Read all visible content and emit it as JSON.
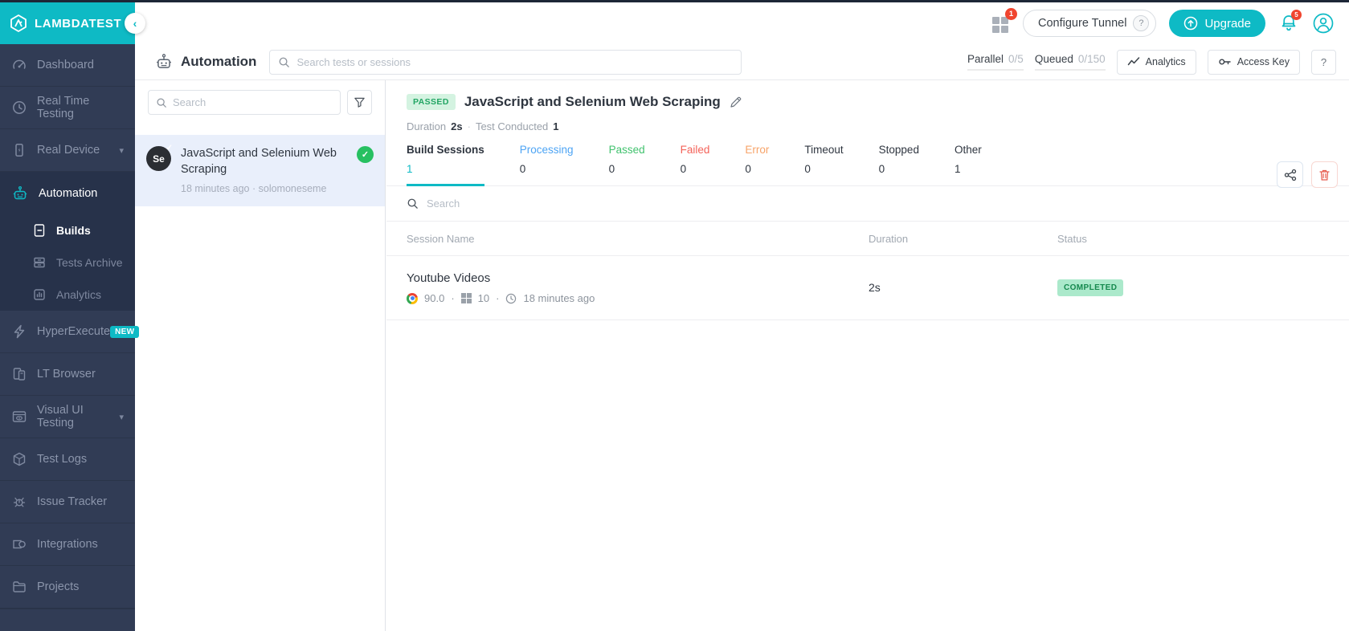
{
  "brand": {
    "name": "LAMBDATEST",
    "teal": "#0ebac5"
  },
  "sidebar": {
    "items": [
      {
        "label": "Dashboard"
      },
      {
        "label": "Real Time Testing"
      },
      {
        "label": "Real Device"
      },
      {
        "label": "Automation"
      },
      {
        "label": "Builds"
      },
      {
        "label": "Tests Archive"
      },
      {
        "label": "Analytics"
      },
      {
        "label": "HyperExecute",
        "badge": "NEW"
      },
      {
        "label": "LT Browser"
      },
      {
        "label": "Visual UI Testing"
      },
      {
        "label": "Test Logs"
      },
      {
        "label": "Issue Tracker"
      },
      {
        "label": "Integrations"
      },
      {
        "label": "Projects"
      }
    ]
  },
  "topbar": {
    "apps_badge": "1",
    "configure_tunnel_label": "Configure Tunnel",
    "tunnel_help": "?",
    "upgrade_label": "Upgrade",
    "bell_badge": "5"
  },
  "header": {
    "title": "Automation",
    "search_placeholder": "Search tests or sessions",
    "parallel_label": "Parallel",
    "parallel_value": "0/5",
    "queued_label": "Queued",
    "queued_value": "0/150",
    "analytics_button": "Analytics",
    "access_key_button": "Access Key",
    "help_button": "?"
  },
  "build_list": {
    "search_placeholder": "Search",
    "items": [
      {
        "title": "JavaScript and Selenium Web Scraping",
        "time": "18 minutes ago",
        "separator": "·",
        "user": "solomoneseme",
        "status": "passed"
      }
    ]
  },
  "detail": {
    "status_badge": "PASSED",
    "title": "JavaScript and Selenium Web Scraping",
    "duration_label": "Duration",
    "duration_value": "2s",
    "meta_separator": "·",
    "tests_label": "Test Conducted",
    "tests_value": "1",
    "tabs": [
      {
        "label": "Build Sessions",
        "count": "1",
        "color": "#2f3640",
        "count_color": "#0ebac5",
        "active": true
      },
      {
        "label": "Processing",
        "count": "0",
        "color": "#4da4f4"
      },
      {
        "label": "Passed",
        "count": "0",
        "color": "#41c26e"
      },
      {
        "label": "Failed",
        "count": "0",
        "color": "#f4635a"
      },
      {
        "label": "Error",
        "count": "0",
        "color": "#f7a46a"
      },
      {
        "label": "Timeout",
        "count": "0",
        "color": "#2f3640"
      },
      {
        "label": "Stopped",
        "count": "0",
        "color": "#2f3640"
      },
      {
        "label": "Other",
        "count": "1",
        "color": "#2f3640"
      }
    ],
    "session_search_placeholder": "Search",
    "table": {
      "columns": [
        "Session Name",
        "Duration",
        "Status"
      ],
      "rows": [
        {
          "name": "Youtube Videos",
          "browser_version": "90.0",
          "os_version": "10",
          "time": "18 minutes ago",
          "separator": "·",
          "duration": "2s",
          "status": "COMPLETED"
        }
      ]
    }
  }
}
